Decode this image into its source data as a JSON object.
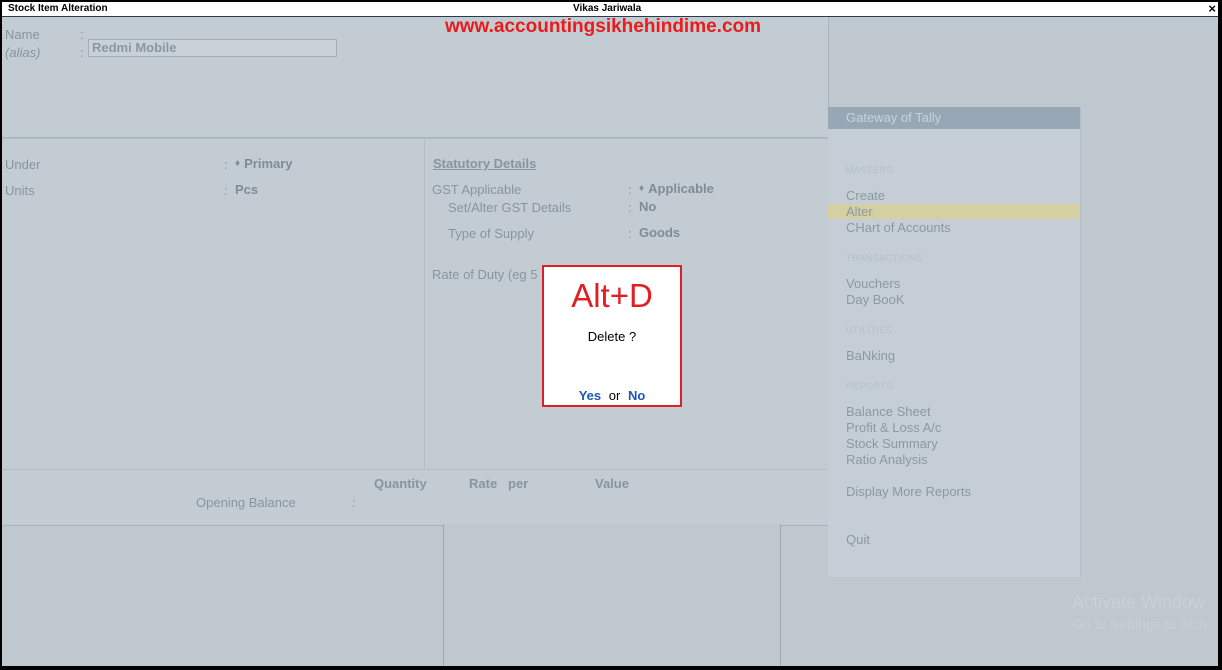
{
  "window": {
    "title": "Stock Item Alteration",
    "user": "Vikas Jariwala",
    "close": "×"
  },
  "watermark": {
    "site": "www.accountingsikhehindime.com",
    "activate_line1": "Activate Window",
    "activate_line2": "Go to Settings to activ"
  },
  "form": {
    "name_label": "Name",
    "name_value": "Redmi Mobile",
    "alias_label": "(alias)",
    "colon": ":",
    "under_label": "Under",
    "under_value": "Primary",
    "units_label": "Units",
    "units_value": "Pcs",
    "statutory_title": "Statutory Details",
    "gst_applicable_label": "GST Applicable",
    "gst_applicable_value": "Applicable",
    "set_alter_label": "Set/Alter GST Details",
    "set_alter_value": "No",
    "supply_label": "Type of Supply",
    "supply_value": "Goods",
    "rate_duty_label": "Rate of Duty (eg 5",
    "diamond": "♦"
  },
  "opening": {
    "quantity_head": "Quantity",
    "rate_head": "Rate",
    "per_head": "per",
    "value_head": "Value",
    "opening_label": "Opening Balance"
  },
  "gateway": {
    "title": "Gateway of Tally",
    "masters_section": "MASTERS",
    "create": "Create",
    "alter": "Alter",
    "chart": "CHart of Accounts",
    "transactions_section": "TRANSACTIONS",
    "vouchers": "Vouchers",
    "daybook": "Day BooK",
    "utilities_section": "UTILITIES",
    "banking": "BaNking",
    "reports_section": "REPORTS",
    "balance_sheet": "Balance Sheet",
    "profit_loss": "Profit & Loss A/c",
    "stock_summary": "Stock Summary",
    "ratio": "Ratio Analysis",
    "display_more": "Display More Reports",
    "quit": "Quit"
  },
  "dialog": {
    "shortcut": "Alt+D",
    "question": "Delete ?",
    "yes": "Yes",
    "or": "or",
    "no": "No"
  },
  "colors": {
    "accent_red": "#e01f24",
    "link_blue": "#1e57b6",
    "highlight": "#d4d0a2"
  }
}
